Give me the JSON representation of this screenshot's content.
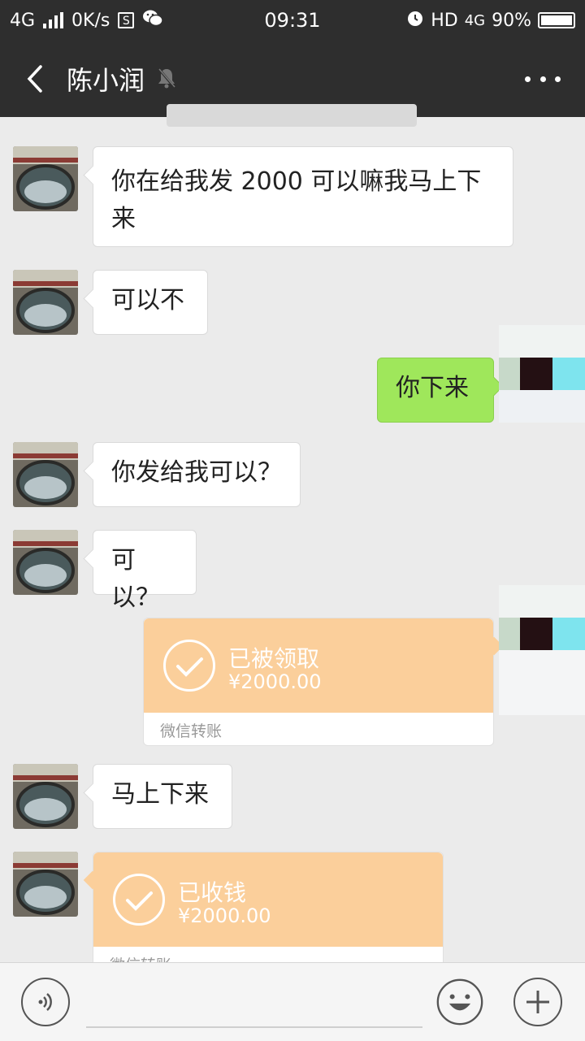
{
  "status_bar": {
    "network": "4G",
    "speed": "0K/s",
    "s_badge": "S",
    "time": "09:31",
    "hd": "HD",
    "network2": "4G",
    "battery": "90%",
    "battery_level": 0.9
  },
  "header": {
    "contact_name": "陈小润",
    "back_icon": "back-chevron-icon",
    "mute_icon": "muted-bell-icon",
    "more_icon": "more-dots-icon"
  },
  "messages": [
    {
      "side": "left",
      "type": "text",
      "text": "你在给我发 2000 可以嘛我马上下来"
    },
    {
      "side": "left",
      "type": "text",
      "text": "可以不"
    },
    {
      "side": "right",
      "type": "text",
      "text": "你下来"
    },
    {
      "side": "left",
      "type": "text",
      "text": "你发给我可以？"
    },
    {
      "side": "left",
      "type": "text",
      "text": "可以？"
    },
    {
      "side": "right",
      "type": "transfer",
      "status": "已被领取",
      "amount": "¥2000.00",
      "label": "微信转账"
    },
    {
      "side": "left",
      "type": "text",
      "text": "马上下来"
    },
    {
      "side": "left",
      "type": "transfer",
      "status": "已收钱",
      "amount": "¥2000.00",
      "label": "微信转账"
    }
  ],
  "input_bar": {
    "voice_icon": "voice-icon",
    "emoji_icon": "emoji-icon",
    "add_icon": "plus-icon"
  }
}
